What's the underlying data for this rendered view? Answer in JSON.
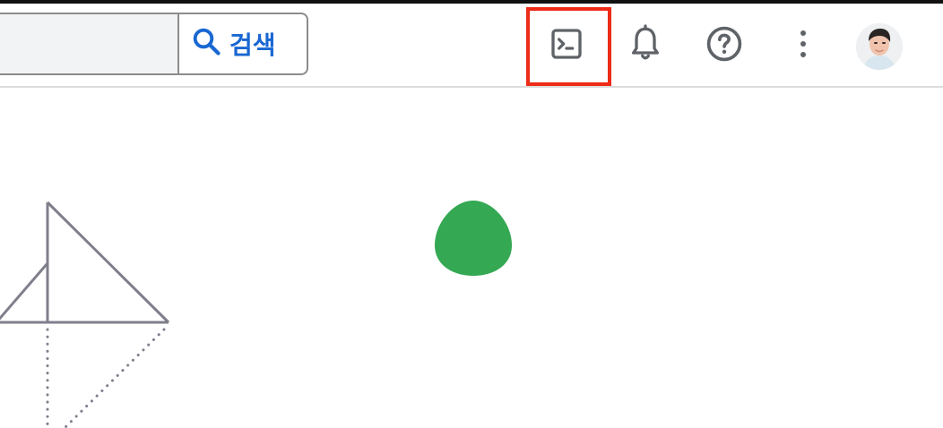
{
  "header": {
    "search": {
      "placeholder": "",
      "value": "",
      "button_label": "검색"
    },
    "icons": {
      "terminal": "terminal-icon",
      "notifications": "bell-icon",
      "help": "help-icon",
      "more": "more-vert-icon",
      "avatar": "avatar"
    }
  },
  "colors": {
    "accent": "#1967d2",
    "highlight": "#ee2b16",
    "illustration_green": "#34a853",
    "illustration_stroke": "#7f7f8c",
    "icon": "#5f6368"
  }
}
